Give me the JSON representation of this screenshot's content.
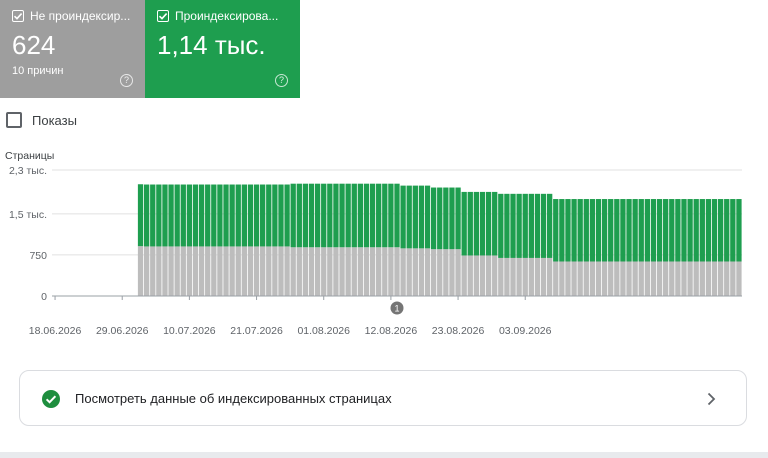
{
  "tiles": [
    {
      "label": "Не проиндексир...",
      "value": "624",
      "sub": "10 причин",
      "color": "#9e9e9e",
      "checked": true
    },
    {
      "label": "Проиндексирова...",
      "value": "1,14 тыс.",
      "sub": "",
      "color": "#1e9e4f",
      "checked": true
    }
  ],
  "impressions_label": "Показы",
  "link_card": {
    "text": "Посмотреть данные об индексированных страницах"
  },
  "colors": {
    "indexed": "#1e9e4f",
    "not_indexed": "#bdbdbd",
    "grid": "#e0e0e0"
  },
  "chart_data": {
    "type": "bar",
    "stacked": true,
    "ylabel": "Страницы",
    "y_ticks": [
      "0",
      "750",
      "1,5 тыс.",
      "2,3 тыс."
    ],
    "y_tick_values": [
      0,
      750,
      1500,
      2300
    ],
    "ylim": [
      0,
      2300
    ],
    "x_tick_labels": [
      "18.06.2026",
      "29.06.2026",
      "10.07.2026",
      "21.07.2026",
      "01.08.2026",
      "12.08.2026",
      "23.08.2026",
      "03.09.2026"
    ],
    "annotation": {
      "label": "1",
      "date": "13.08.2026"
    },
    "x_start": "18.06.2026",
    "x_end": "05.09.2026",
    "series": [
      {
        "values": [
          0,
          0,
          0,
          0,
          0,
          0,
          0,
          0,
          0,
          0,
          0,
          0,
          0,
          0,
          910,
          905,
          905,
          905,
          905,
          905,
          905,
          905,
          905,
          905,
          905,
          905,
          905,
          905,
          905,
          905,
          905,
          905,
          905,
          905,
          905,
          905,
          905,
          905,
          905,
          890,
          890,
          890,
          890,
          890,
          890,
          890,
          890,
          890,
          890,
          890,
          890,
          890,
          890,
          890,
          890,
          890,
          890,
          870,
          870,
          870,
          870,
          870,
          855,
          855,
          855,
          855,
          855,
          740,
          740,
          740,
          740,
          740,
          740,
          695,
          695,
          695,
          695,
          695,
          695,
          695,
          695,
          695,
          630,
          630,
          630,
          630,
          630,
          630,
          630,
          630,
          630,
          630,
          630,
          630,
          630,
          630,
          630,
          630,
          630,
          630,
          630,
          630,
          630,
          630,
          630,
          630,
          630,
          630,
          630,
          630,
          630,
          630,
          630
        ]
      },
      {
        "values": [
          0,
          0,
          0,
          0,
          0,
          0,
          0,
          0,
          0,
          0,
          0,
          0,
          0,
          0,
          1130,
          1130,
          1130,
          1130,
          1130,
          1130,
          1130,
          1130,
          1130,
          1130,
          1130,
          1130,
          1130,
          1130,
          1130,
          1130,
          1130,
          1130,
          1130,
          1130,
          1130,
          1130,
          1130,
          1130,
          1130,
          1160,
          1160,
          1160,
          1160,
          1160,
          1160,
          1160,
          1160,
          1160,
          1160,
          1160,
          1160,
          1160,
          1160,
          1160,
          1160,
          1160,
          1160,
          1145,
          1145,
          1145,
          1145,
          1145,
          1125,
          1125,
          1125,
          1125,
          1125,
          1160,
          1160,
          1160,
          1160,
          1160,
          1160,
          1170,
          1170,
          1170,
          1170,
          1170,
          1170,
          1170,
          1170,
          1170,
          1140,
          1140,
          1140,
          1140,
          1140,
          1140,
          1140,
          1140,
          1140,
          1140,
          1140,
          1140,
          1140,
          1140,
          1140,
          1140,
          1140,
          1140,
          1140,
          1140,
          1140,
          1140,
          1140,
          1140,
          1140,
          1140,
          1140,
          1140,
          1140,
          1140,
          1140
        ]
      }
    ]
  }
}
